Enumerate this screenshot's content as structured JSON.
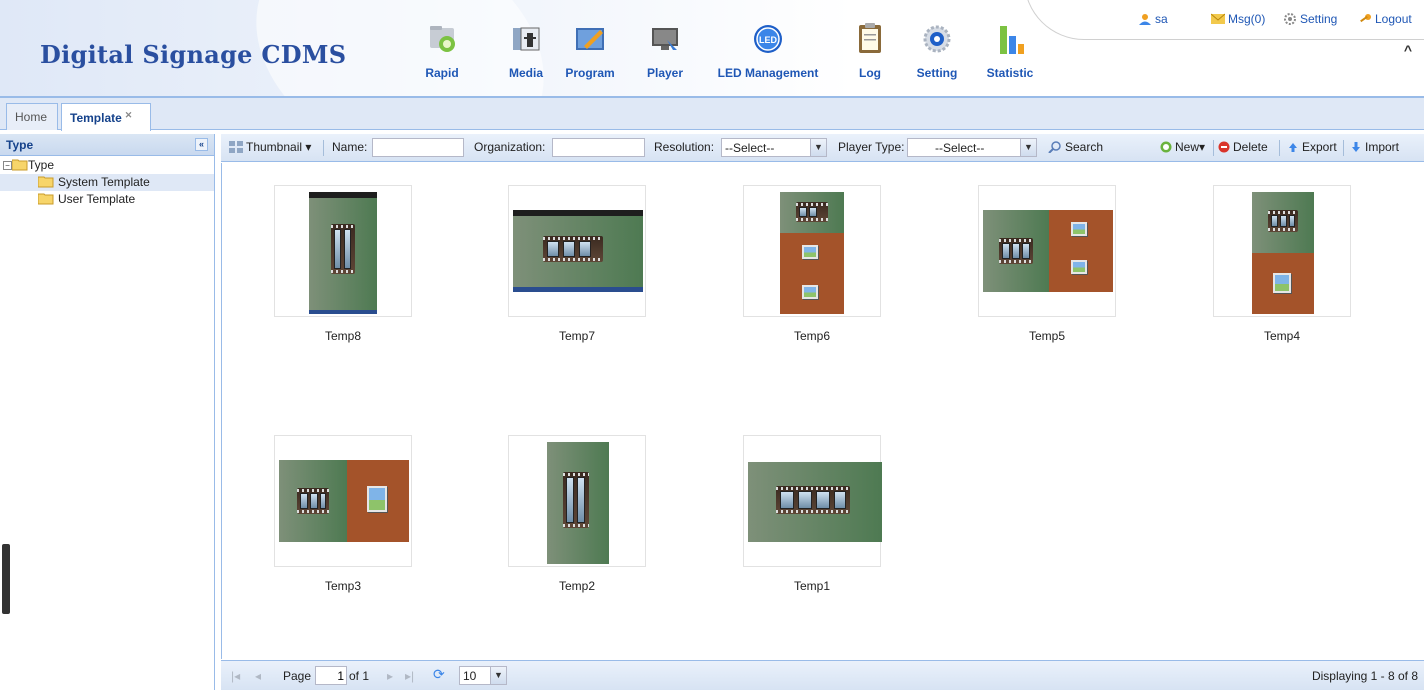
{
  "header": {
    "title": "Digital Signage CDMS",
    "modules": [
      {
        "label": "Rapid",
        "icon": "rapid-icon"
      },
      {
        "label": "Media",
        "icon": "media-icon"
      },
      {
        "label": "Program",
        "icon": "program-icon"
      },
      {
        "label": "Player",
        "icon": "player-icon"
      },
      {
        "label": "LED Management",
        "icon": "led-icon"
      },
      {
        "label": "Log",
        "icon": "log-icon"
      },
      {
        "label": "Setting",
        "icon": "setting-icon"
      },
      {
        "label": "Statistic",
        "icon": "statistic-icon"
      }
    ],
    "user": {
      "username": "sa",
      "messages": "Msg(0)",
      "setting": "Setting",
      "logout": "Logout"
    }
  },
  "tabs": [
    {
      "label": "Home",
      "active": false
    },
    {
      "label": "Template",
      "active": true,
      "closable": true
    }
  ],
  "left_panel": {
    "title": "Type",
    "tree": {
      "root": "Type",
      "children": [
        "System Template",
        "User Template"
      ],
      "selected": "System Template"
    }
  },
  "toolbar": {
    "view_label": "Thumbnail",
    "name_label": "Name:",
    "name_value": "",
    "organization_label": "Organization:",
    "organization_value": "",
    "resolution_label": "Resolution:",
    "resolution_value": "--Select--",
    "player_type_label": "Player Type:",
    "player_type_value": "--Select--",
    "search_label": "Search",
    "new_label": "New",
    "delete_label": "Delete",
    "export_label": "Export",
    "import_label": "Import"
  },
  "templates": [
    {
      "name": "Temp8",
      "layout": "portrait-full"
    },
    {
      "name": "Temp7",
      "layout": "landscape-full"
    },
    {
      "name": "Temp6",
      "layout": "portrait-three"
    },
    {
      "name": "Temp5",
      "layout": "landscape-split-two"
    },
    {
      "name": "Temp4",
      "layout": "portrait-two"
    },
    {
      "name": "Temp3",
      "layout": "landscape-split"
    },
    {
      "name": "Temp2",
      "layout": "portrait-plain"
    },
    {
      "name": "Temp1",
      "layout": "landscape-plain"
    }
  ],
  "paging": {
    "page_label": "Page",
    "page_value": "1",
    "of_label": "of 1",
    "page_size": "10",
    "display_info": "Displaying 1 - 8 of 8"
  },
  "colors": {
    "brand_blue": "#2a4fa0",
    "link_blue": "#1f57b5",
    "panel_border": "#99bbe8",
    "template_green": "#4e7a52",
    "template_rust": "#a4532a"
  }
}
